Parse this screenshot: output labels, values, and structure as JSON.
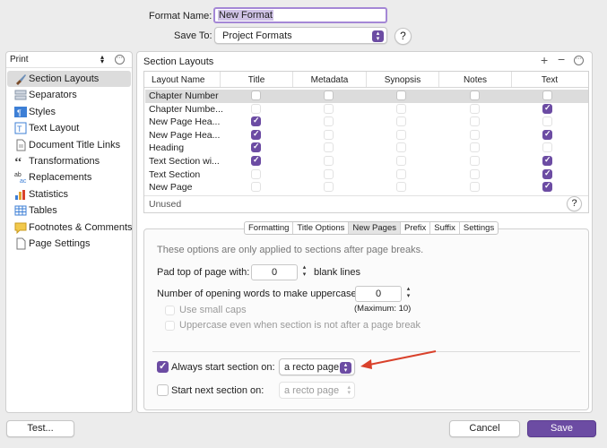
{
  "header": {
    "format_name_label": "Format Name:",
    "format_name_value": "New Format",
    "save_to_label": "Save To:",
    "save_to_value": "Project Formats",
    "help": "?"
  },
  "sidebar": {
    "mode": "Print",
    "items": [
      {
        "label": "Section Layouts",
        "icon": "brush-icon"
      },
      {
        "label": "Separators",
        "icon": "separator-icon"
      },
      {
        "label": "Styles",
        "icon": "styles-icon"
      },
      {
        "label": "Text Layout",
        "icon": "text-layout-icon"
      },
      {
        "label": "Document Title Links",
        "icon": "document-icon"
      },
      {
        "label": "Transformations",
        "icon": "quotes-icon"
      },
      {
        "label": "Replacements",
        "icon": "replace-icon"
      },
      {
        "label": "Statistics",
        "icon": "statistics-icon"
      },
      {
        "label": "Tables",
        "icon": "table-icon"
      },
      {
        "label": "Footnotes & Comments",
        "icon": "note-icon"
      },
      {
        "label": "Page Settings",
        "icon": "page-icon"
      }
    ]
  },
  "section_layouts": {
    "title": "Section Layouts",
    "columns": [
      "Layout Name",
      "Title",
      "Metadata",
      "Synopsis",
      "Notes",
      "Text"
    ],
    "rows": [
      {
        "name": "Chapter Number",
        "checks": [
          false,
          false,
          false,
          false,
          false
        ]
      },
      {
        "name": "Chapter Numbe...",
        "checks": [
          false,
          false,
          false,
          false,
          true
        ]
      },
      {
        "name": "New Page Hea...",
        "checks": [
          true,
          false,
          false,
          false,
          false
        ]
      },
      {
        "name": "New Page Hea...",
        "checks": [
          true,
          false,
          false,
          false,
          true
        ]
      },
      {
        "name": "Heading",
        "checks": [
          true,
          false,
          false,
          false,
          false
        ]
      },
      {
        "name": "Text Section wi...",
        "checks": [
          true,
          false,
          false,
          false,
          true
        ]
      },
      {
        "name": "Text Section",
        "checks": [
          false,
          false,
          false,
          false,
          true
        ]
      },
      {
        "name": "New Page",
        "checks": [
          false,
          false,
          false,
          false,
          true
        ]
      }
    ],
    "unused_label": "Unused"
  },
  "tabs": [
    "Formatting",
    "Title Options",
    "New Pages",
    "Prefix",
    "Suffix",
    "Settings"
  ],
  "new_pages": {
    "info": "These options are only applied to sections after page breaks.",
    "pad_label": "Pad top of page with:",
    "pad_value": "0",
    "pad_suffix": "blank lines",
    "uppercase_label": "Number of opening words to make uppercase:",
    "uppercase_value": "0",
    "uppercase_max": "(Maximum: 10)",
    "small_caps": "Use small caps",
    "uppercase_even": "Uppercase even when section is not after a page break",
    "always_start_label": "Always start section on:",
    "always_start_value": "a recto page",
    "start_next_label": "Start next section on:",
    "start_next_value": "a recto page"
  },
  "footer": {
    "test": "Test...",
    "cancel": "Cancel",
    "save": "Save"
  },
  "colors": {
    "accent": "#6c4ca3",
    "arrow": "#d9412b"
  }
}
